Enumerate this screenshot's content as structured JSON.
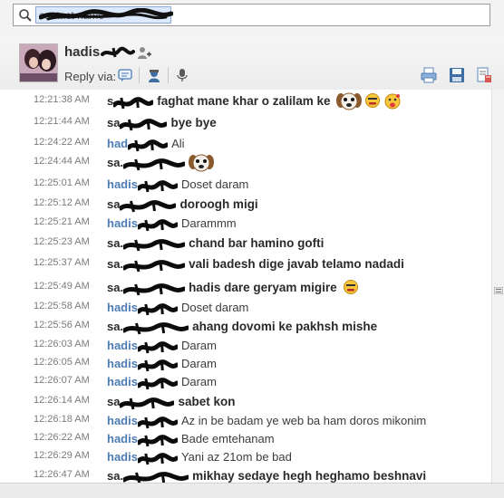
{
  "search": {
    "value": "contact name"
  },
  "header": {
    "contact_name": "hadis",
    "reply_label": "Reply via:"
  },
  "colors": {
    "sender_me": "#2a2a2a",
    "sender_them": "#4d7bb3",
    "timestamp": "#7b7b7b"
  },
  "messages": [
    {
      "time": "12:21:38 AM",
      "sender": "s",
      "side": "me",
      "text": "faghat mane khar o zalilam ke",
      "emoticons": [
        "dog-face-icon",
        "embarrassed-emoticon",
        "tongue-emoticon"
      ]
    },
    {
      "time": "12:21:44 AM",
      "sender": "sa",
      "side": "me",
      "text": "bye bye",
      "emoticons": []
    },
    {
      "time": "12:24:22 AM",
      "sender": "had",
      "side": "them",
      "text": "Ali",
      "emoticons": []
    },
    {
      "time": "12:24:44 AM",
      "sender": "sa.",
      "side": "me",
      "text": "",
      "emoticons": [
        "dog-face-icon"
      ]
    },
    {
      "time": "12:25:01 AM",
      "sender": "hadis",
      "side": "them",
      "text": "Doset daram",
      "emoticons": []
    },
    {
      "time": "12:25:12 AM",
      "sender": "sa",
      "side": "me",
      "text": "doroogh migi",
      "emoticons": []
    },
    {
      "time": "12:25:21 AM",
      "sender": "hadis",
      "side": "them",
      "text": "Darammm",
      "emoticons": []
    },
    {
      "time": "12:25:23 AM",
      "sender": "sa.",
      "side": "me",
      "text": "chand bar hamino gofti",
      "emoticons": []
    },
    {
      "time": "12:25:37 AM",
      "sender": "sa.",
      "side": "me",
      "text": "vali badesh dige javab telamo nadadi",
      "emoticons": []
    },
    {
      "time": "12:25:49 AM",
      "sender": "sa.",
      "side": "me",
      "text": "hadis dare geryam migire",
      "emoticons": [
        "embarrassed-emoticon"
      ]
    },
    {
      "time": "12:25:58 AM",
      "sender": "hadis",
      "side": "them",
      "text": "Doset daram",
      "emoticons": []
    },
    {
      "time": "12:25:56 AM",
      "sender": "sa.",
      "side": "me",
      "text": "ahang dovomi ke pakhsh mishe",
      "emoticons": []
    },
    {
      "time": "12:26:03 AM",
      "sender": "hadis",
      "side": "them",
      "text": "Daram",
      "emoticons": []
    },
    {
      "time": "12:26:05 AM",
      "sender": "hadis",
      "side": "them",
      "text": "Daram",
      "emoticons": []
    },
    {
      "time": "12:26:07 AM",
      "sender": "hadis",
      "side": "them",
      "text": "Daram",
      "emoticons": []
    },
    {
      "time": "12:26:14 AM",
      "sender": "sa",
      "side": "me",
      "text": "sabet kon",
      "emoticons": []
    },
    {
      "time": "12:26:18 AM",
      "sender": "hadis",
      "side": "them",
      "text": "Az in be badam ye web ba ham doros mikonim",
      "emoticons": []
    },
    {
      "time": "12:26:22 AM",
      "sender": "hadis",
      "side": "them",
      "text": "Bade emtehanam",
      "emoticons": []
    },
    {
      "time": "12:26:29 AM",
      "sender": "hadis",
      "side": "them",
      "text": "Yani az 21om be bad",
      "emoticons": []
    },
    {
      "time": "12:26:47 AM",
      "sender": "sa.",
      "side": "me",
      "text": "mikhay sedaye hegh heghamo beshnavi",
      "emoticons": []
    }
  ]
}
